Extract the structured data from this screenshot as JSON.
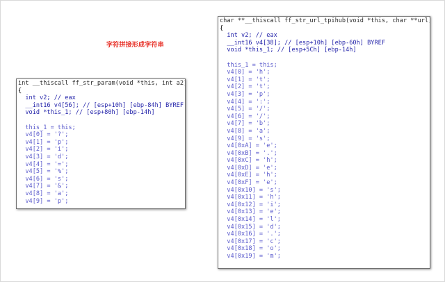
{
  "caption": "字符拼接形成字符串",
  "left_panel": {
    "lines": [
      "int __thiscall ff_str_param(void *this, int a2)",
      "{",
      "  int v2; // eax",
      "  __int16 v4[56]; // [esp+10h] [ebp-84h] BYREF",
      "  void *this_1; // [esp+80h] [ebp-14h]",
      "",
      "  this_1 = this;",
      "  v4[0] = '?';",
      "  v4[1] = 'p';",
      "  v4[2] = 'i';",
      "  v4[3] = 'd';",
      "  v4[4] = '=';",
      "  v4[5] = '%';",
      "  v4[6] = 's';",
      "  v4[7] = '&';",
      "  v4[8] = 'a';",
      "  v4[9] = 'p';"
    ]
  },
  "right_panel": {
    "lines": [
      "char **__thiscall ff_str_url_tpihub(void *this, char **url)",
      "{",
      "  int v2; // eax",
      "  __int16 v4[38]; // [esp+10h] [ebp-60h] BYREF",
      "  void *this_1; // [esp+5Ch] [ebp-14h]",
      "",
      "  this_1 = this;",
      "  v4[0] = 'h';",
      "  v4[1] = 't';",
      "  v4[2] = 't';",
      "  v4[3] = 'p';",
      "  v4[4] = ':';",
      "  v4[5] = '/';",
      "  v4[6] = '/';",
      "  v4[7] = 'b';",
      "  v4[8] = 'a';",
      "  v4[9] = 's';",
      "  v4[0xA] = 'e';",
      "  v4[0xB] = '.';",
      "  v4[0xC] = 'h';",
      "  v4[0xD] = 'e';",
      "  v4[0xE] = 'h';",
      "  v4[0xF] = 'e';",
      "  v4[0x10] = 's';",
      "  v4[0x11] = 'h';",
      "  v4[0x12] = 'i';",
      "  v4[0x13] = 'e';",
      "  v4[0x14] = 'l';",
      "  v4[0x15] = 'd';",
      "  v4[0x16] = '.';",
      "  v4[0x17] = 'c';",
      "  v4[0x18] = 'o';",
      "  v4[0x19] = 'm';"
    ]
  }
}
